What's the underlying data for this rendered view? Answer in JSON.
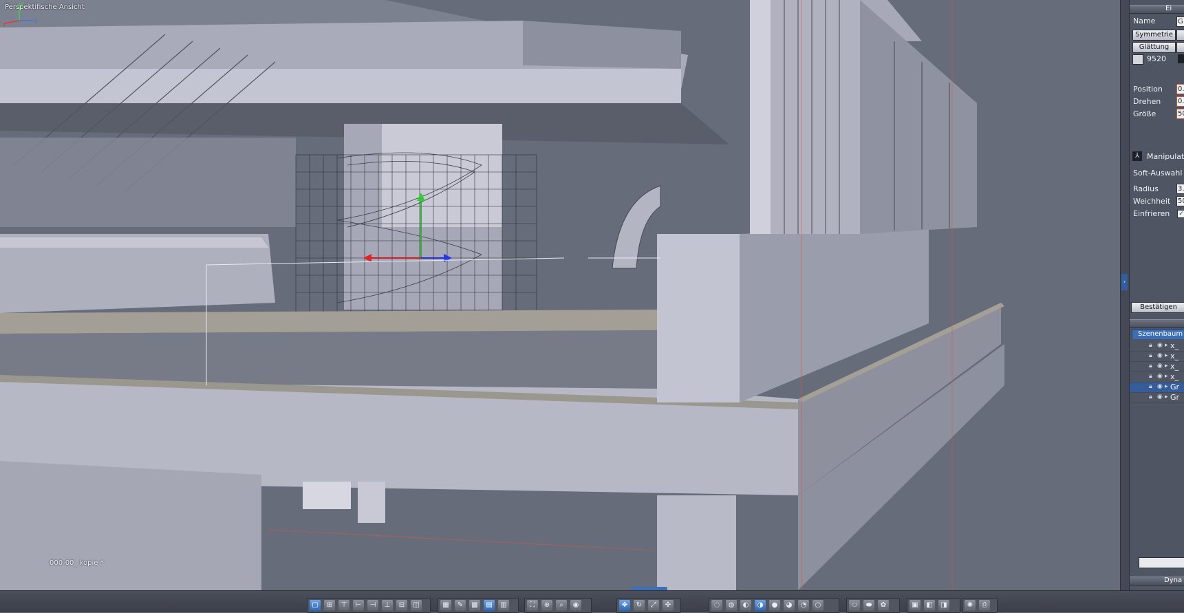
{
  "viewport": {
    "title": "Perspektifische Ansicht",
    "object_name": "000-00_ kopie *"
  },
  "panel": {
    "header1": "Ei",
    "name_label": "Name",
    "name_value": "G",
    "symmetrie_label": "Symmetrie",
    "glaettung_label": "Glättung",
    "poly_count": "9520",
    "position_label": "Position",
    "position_value": "0.",
    "drehen_label": "Drehen",
    "drehen_value": "0.",
    "groesse_label": "Größe",
    "groesse_value": "50",
    "manipulator_label": "Manipulato",
    "softauswahl_label": "Soft-Auswahl",
    "radius_label": "Radius",
    "radius_value": "3.",
    "weichheit_label": "Weichheit",
    "weichheit_value": "50",
    "einfrieren_label": "Einfrieren",
    "bestaetigen_label": "Bestätigen",
    "tree_tab": "Szenenbaum",
    "tree_items": [
      {
        "name": "x_",
        "selected": false
      },
      {
        "name": "x_",
        "selected": false
      },
      {
        "name": "x_",
        "selected": false
      },
      {
        "name": "x_",
        "selected": false
      },
      {
        "name": "Gr",
        "selected": true
      },
      {
        "name": "Gr",
        "selected": false
      }
    ],
    "footer_header": "Dyna"
  },
  "colors": {
    "accent": "#3c6db5",
    "viewport_bg": "#666b79",
    "geometry_face": "#b8bac8",
    "geometry_floor": "#9a978f"
  }
}
